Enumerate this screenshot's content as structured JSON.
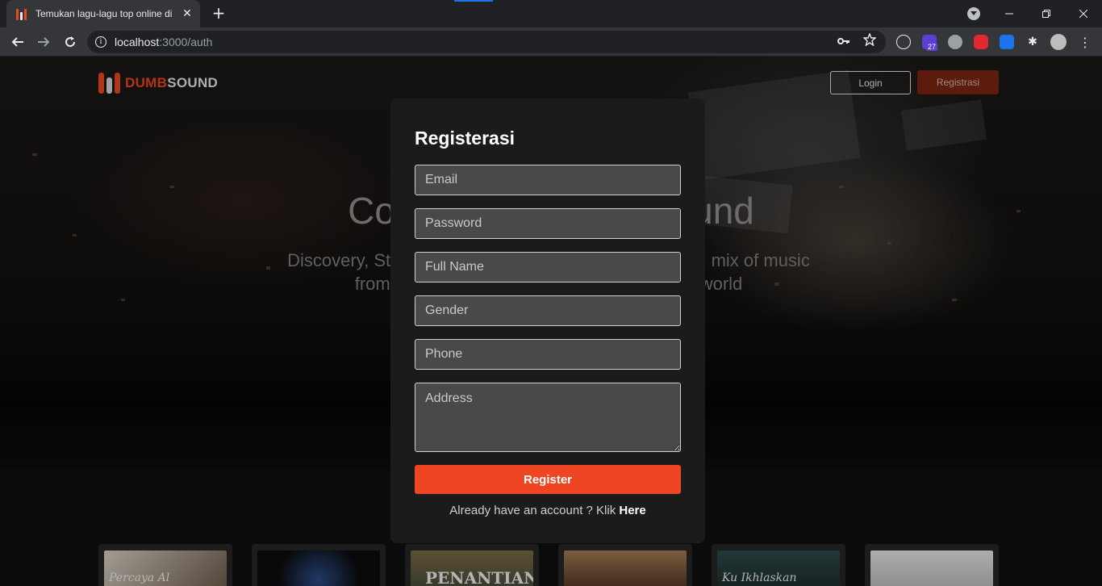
{
  "browser": {
    "tab_title": "Temukan lagu-lagu top online di",
    "tab_close": "✕",
    "new_tab": "+",
    "url_host": "localhost",
    "url_path": ":3000/auth",
    "extension_badge": "27"
  },
  "header": {
    "logo_part1": "DUMB",
    "logo_part2": "SOUND",
    "login_label": "Login",
    "register_label": "Registrasi"
  },
  "hero": {
    "title": "Connect on DumbSound",
    "subtitle": "Discovery, Stream, and share a constantly expanding mix of music from emerging and major artists around the world"
  },
  "modal": {
    "title": "Registerasi",
    "email_placeholder": "Email",
    "password_placeholder": "Password",
    "fullname_placeholder": "Full Name",
    "gender_placeholder": "Gender",
    "phone_placeholder": "Phone",
    "address_placeholder": "Address",
    "submit_label": "Register",
    "footer_prefix": "Already have an account ? Klik ",
    "footer_link": "Here"
  },
  "albums": [
    {
      "label": "Percaya Al"
    },
    {
      "label": ""
    },
    {
      "label": "PENANTIAN"
    },
    {
      "label": ""
    },
    {
      "label": "Ku Ikhlaskan"
    },
    {
      "label": ""
    }
  ],
  "colors": {
    "accent": "#ee4622",
    "modal_bg": "#1b1b1b",
    "field_bg": "#494949"
  }
}
